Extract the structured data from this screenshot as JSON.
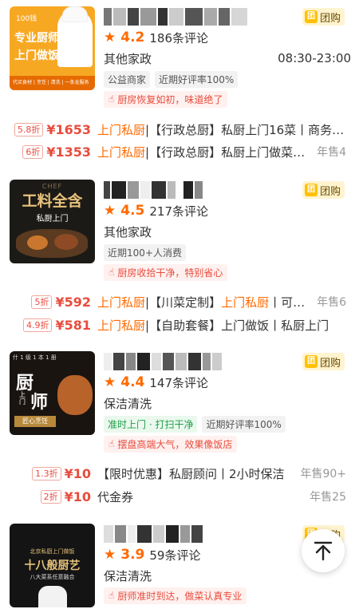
{
  "colors": {
    "accent": "#ff6a00",
    "price": "#e84c3d",
    "green_tag": "#1e9e48",
    "group_badge": "#ffc107"
  },
  "group_buy_label": "团购",
  "group_buy_icon_text": "团",
  "cards": [
    {
      "thumb_lines": [
        "专业厨师",
        "上门做饭"
      ],
      "thumb_brand": "100钱",
      "thumb_footer": "代买食材 | 烹饪 | 清洗 | 一条龙服务",
      "rating": "4.2",
      "reviews": "186条评论",
      "category": "其他家政",
      "hours": "08:30-23:00",
      "tags": [
        "公益商家",
        "近期好评率100%"
      ],
      "review_snippet": "厨房恢复如初，味道绝了",
      "deals": [
        {
          "discount": "5.8折",
          "price": "¥1653",
          "desc_hl": "上门私厨",
          "desc": "|【行政总厨】私厨上门16菜丨商务…",
          "sales": ""
        },
        {
          "discount": "6折",
          "price": "¥1353",
          "desc_hl": "上门私厨",
          "desc": "|【行政总厨】私厨上门做菜…",
          "sales": "年售4"
        }
      ]
    },
    {
      "thumb_lines": [
        "工料全含",
        "私厨上门"
      ],
      "thumb_brand": "CHEF",
      "rating": "4.5",
      "reviews": "217条评论",
      "category": "其他家政",
      "hours": "",
      "tags": [
        "近期100+人消费"
      ],
      "review_snippet": "厨房收拾干净，特别省心",
      "deals": [
        {
          "discount": "5折",
          "price": "¥592",
          "desc_hl": "上门私厨",
          "desc": "|【川菜定制】",
          "desc_hl2": "上门私厨",
          "desc2": "丨可…",
          "sales": "年售6"
        },
        {
          "discount": "4.9折",
          "price": "¥581",
          "desc_hl": "上门私厨",
          "desc": "|【自助套餐】上门做饭丨私厨上门",
          "sales": ""
        }
      ]
    },
    {
      "thumb_lines": [
        "厨",
        "上门",
        "师"
      ],
      "thumb_top": "什 1 级 1 本 1 册",
      "thumb_footer": "匠心烹饪",
      "rating": "4.4",
      "reviews": "147条评论",
      "category": "保洁清洗",
      "hours": "",
      "tags": [
        "准时上门 · 打扫干净",
        "近期好评率100%"
      ],
      "review_snippet": "摆盘高端大气，效果像饭店",
      "deals": [
        {
          "discount": "1.3折",
          "price": "¥10",
          "desc_hl": "",
          "desc": "【限时优惠】私厨顾问丨2小时保洁",
          "sales": "年售90+"
        },
        {
          "discount": "2折",
          "price": "¥10",
          "desc_hl": "",
          "desc": "代金券",
          "sales": "年售25"
        }
      ]
    },
    {
      "thumb_lines": [
        "十八般厨艺"
      ],
      "thumb_top": "北京私厨上门做饭",
      "thumb_sub": "八大菜系任意融合",
      "rating": "3.9",
      "reviews": "59条评论",
      "category": "保洁清洗",
      "hours": "",
      "tags": [],
      "review_snippet": "厨师准时到达，做菜认真专业",
      "deals": []
    }
  ],
  "back_to_top_icon": "arrow-up-to-top-icon"
}
